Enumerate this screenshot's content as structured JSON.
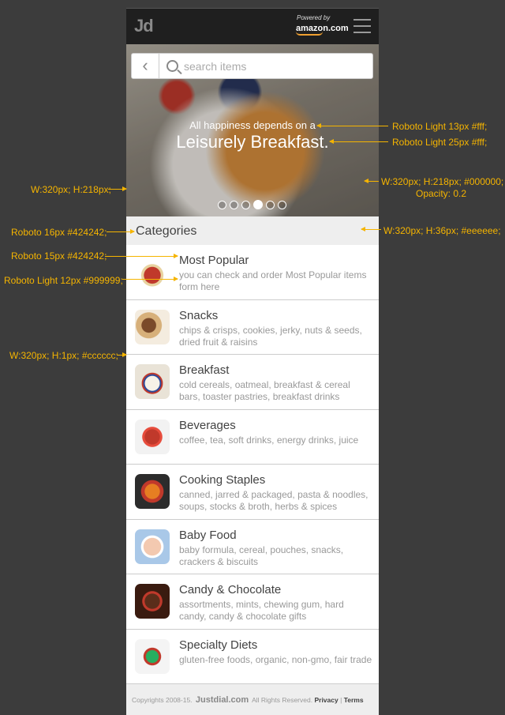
{
  "header": {
    "logo": "Jd",
    "powered_by": "Powered by",
    "amazon": "amazon.com"
  },
  "search": {
    "placeholder": "search items"
  },
  "hero": {
    "line1": "All happiness depends on a",
    "line2": "Leisurely Breakfast.",
    "slides": 6,
    "active_slide": 4
  },
  "categories_title": "Categories",
  "categories": [
    {
      "name": "Most Popular",
      "desc": "you can check and order Most Popular items form here",
      "icon": "basket-icon"
    },
    {
      "name": "Snacks",
      "desc": "chips & crisps, cookies, jerky, nuts & seeds, dried fruit & raisins",
      "icon": "snacks-icon"
    },
    {
      "name": "Breakfast",
      "desc": "cold cereals, oatmeal, breakfast & cereal bars, toaster pastries, breakfast drinks",
      "icon": "breakfast-icon"
    },
    {
      "name": "Beverages",
      "desc": "coffee, tea, soft drinks, energy drinks, juice",
      "icon": "beverages-icon"
    },
    {
      "name": "Cooking Staples",
      "desc": "canned, jarred & packaged, pasta & noodles, soups, stocks & broth, herbs & spices",
      "icon": "pasta-icon"
    },
    {
      "name": "Baby Food",
      "desc": "baby formula, cereal, pouches, snacks, crackers & biscuits",
      "icon": "baby-food-icon"
    },
    {
      "name": "Candy & Chocolate",
      "desc": "assortments, mints, chewing gum, hard candy, candy & chocolate gifts",
      "icon": "chocolate-icon"
    },
    {
      "name": "Specialty Diets",
      "desc": "gluten-free foods, organic, non-gmo, fair trade",
      "icon": "salad-icon"
    }
  ],
  "footer": {
    "copyright": "Copyrights 2008-15.",
    "brand": "Justdial.com",
    "rights": "All Rights Reserved.",
    "privacy": "Privacy",
    "sep": "|",
    "terms": "Terms"
  },
  "annotations": {
    "a1": "Roboto Light 13px #fff;",
    "a2": "Roboto Light 25px #fff;",
    "a3": "W:320px; H:218px;",
    "a4": "W:320px; H:218px; #000000;",
    "a5": "Opacity: 0.2",
    "a6": "Roboto 16px #424242;",
    "a7": "W:320px; H:36px; #eeeeee;",
    "a8": "Roboto 15px #424242;",
    "a9": "Roboto Light 12px #999999;",
    "a10": "W:320px; H:1px; #cccccc;"
  }
}
